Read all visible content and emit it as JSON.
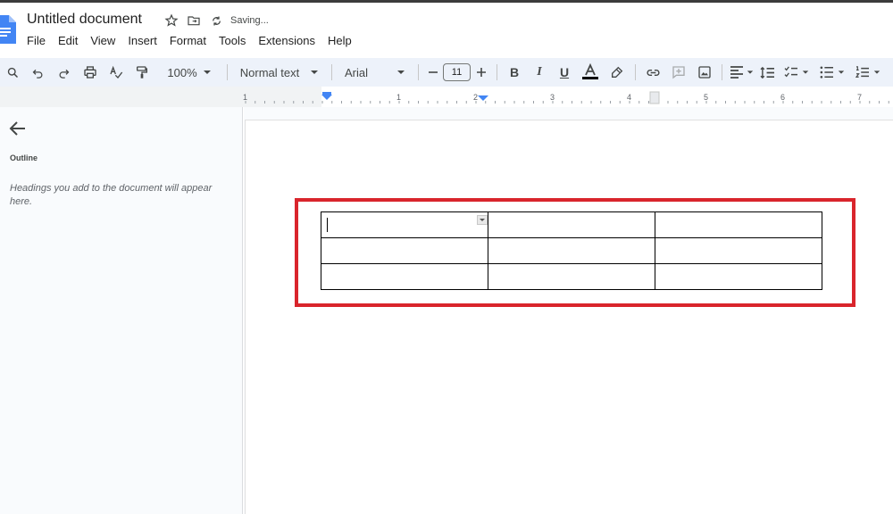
{
  "document": {
    "title": "Untitled document",
    "status": "Saving..."
  },
  "menu": [
    "File",
    "Edit",
    "View",
    "Insert",
    "Format",
    "Tools",
    "Extensions",
    "Help"
  ],
  "toolbar": {
    "zoom": "100%",
    "style": "Normal text",
    "font": "Arial",
    "font_size": "11"
  },
  "ruler": {
    "labels": [
      "1",
      "1",
      "2",
      "3",
      "4",
      "5",
      "6",
      "7"
    ]
  },
  "sidebar": {
    "heading": "Outline",
    "hint": "Headings you add to the document will appear here."
  },
  "table": {
    "rows": 3,
    "cols": 3,
    "cells": [
      [
        "",
        "",
        ""
      ],
      [
        "",
        "",
        ""
      ],
      [
        "",
        "",
        ""
      ]
    ]
  },
  "colors": {
    "highlight": "#d9252c",
    "toolbar_bg": "#edf2fa",
    "docs_blue": "#4285f4"
  },
  "icons": [
    "docs-logo-icon",
    "star-icon",
    "move-folder-icon",
    "sync-icon",
    "search-icon",
    "undo-icon",
    "redo-icon",
    "print-icon",
    "spellcheck-icon",
    "paint-format-icon",
    "bold-icon",
    "italic-icon",
    "underline-icon",
    "text-color-icon",
    "highlight-icon",
    "link-icon",
    "comment-icon",
    "image-icon",
    "align-left-icon",
    "line-spacing-icon",
    "checklist-icon",
    "bullet-list-icon",
    "numbered-list-icon",
    "back-arrow-icon"
  ]
}
